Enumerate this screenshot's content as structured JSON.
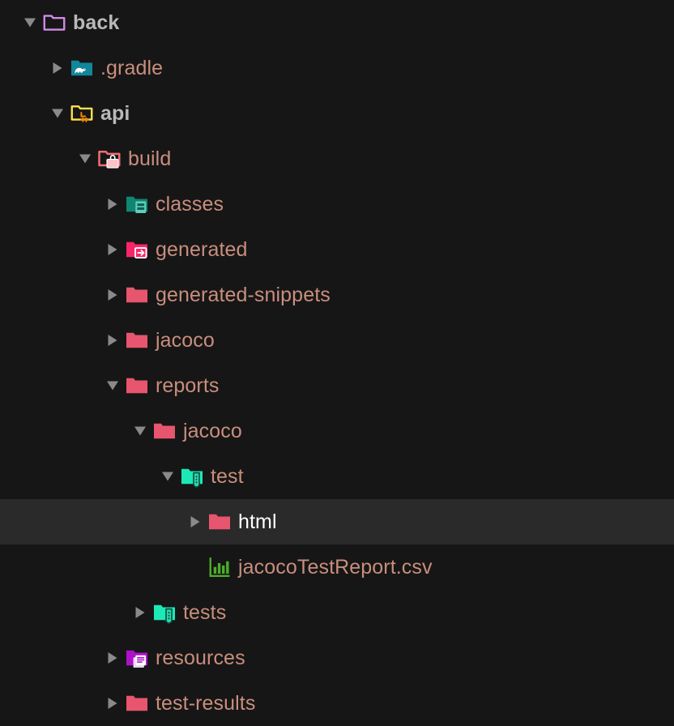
{
  "theme": {
    "background": "#161616",
    "selected_row_background": "#2a2a2a",
    "default_text_color": "#c98e7d",
    "root_text_color": "#b9b9b9",
    "selected_text_color": "#ffffff",
    "twisty_color": "#8a8a8a"
  },
  "file_tree": {
    "title": "back",
    "rows": [
      {
        "label": "back",
        "depth": 0,
        "twisty": "down",
        "icon": "folder-outline-purple-icon",
        "icon_color": "#d08ce8",
        "selected": false,
        "bold": true,
        "type": "folder"
      },
      {
        "label": ".gradle",
        "depth": 1,
        "twisty": "right",
        "icon": "folder-gradle-icon",
        "icon_color": "#11879b",
        "selected": false,
        "bold": false,
        "type": "folder"
      },
      {
        "label": "api",
        "depth": 1,
        "twisty": "down",
        "icon": "folder-module-yellow-icon",
        "icon_color": "#ffe14d",
        "selected": false,
        "bold": true,
        "type": "folder"
      },
      {
        "label": "build",
        "depth": 2,
        "twisty": "down",
        "icon": "folder-build-icon",
        "icon_color": "#ef6e74",
        "selected": false,
        "bold": false,
        "type": "folder"
      },
      {
        "label": "classes",
        "depth": 3,
        "twisty": "right",
        "icon": "folder-classes-icon",
        "icon_color": "#0f8573",
        "selected": false,
        "bold": false,
        "type": "folder"
      },
      {
        "label": "generated",
        "depth": 3,
        "twisty": "right",
        "icon": "folder-generated-icon",
        "icon_color": "#f9256b",
        "selected": false,
        "bold": false,
        "type": "folder"
      },
      {
        "label": "generated-snippets",
        "depth": 3,
        "twisty": "right",
        "icon": "folder-plain-pink-icon",
        "icon_color": "#e8556e",
        "selected": false,
        "bold": false,
        "type": "folder"
      },
      {
        "label": "jacoco",
        "depth": 3,
        "twisty": "right",
        "icon": "folder-plain-pink-icon",
        "icon_color": "#e8556e",
        "selected": false,
        "bold": false,
        "type": "folder"
      },
      {
        "label": "reports",
        "depth": 3,
        "twisty": "down",
        "icon": "folder-plain-pink-icon",
        "icon_color": "#e8556e",
        "selected": false,
        "bold": false,
        "type": "folder"
      },
      {
        "label": "jacoco",
        "depth": 4,
        "twisty": "down",
        "icon": "folder-plain-pink-icon",
        "icon_color": "#e8556e",
        "selected": false,
        "bold": false,
        "type": "folder"
      },
      {
        "label": "test",
        "depth": 5,
        "twisty": "down",
        "icon": "folder-test-icon",
        "icon_color": "#1de9b6",
        "selected": false,
        "bold": false,
        "type": "folder"
      },
      {
        "label": "html",
        "depth": 6,
        "twisty": "right",
        "icon": "folder-plain-pink-icon",
        "icon_color": "#e8556e",
        "selected": true,
        "bold": false,
        "type": "folder"
      },
      {
        "label": "jacocoTestReport.csv",
        "depth": 6,
        "twisty": "none",
        "icon": "csv-chart-icon",
        "icon_color": "#4caf27",
        "selected": false,
        "bold": false,
        "type": "file"
      },
      {
        "label": "tests",
        "depth": 4,
        "twisty": "right",
        "icon": "folder-test-icon",
        "icon_color": "#1de9b6",
        "selected": false,
        "bold": false,
        "type": "folder"
      },
      {
        "label": "resources",
        "depth": 3,
        "twisty": "right",
        "icon": "folder-resources-icon",
        "icon_color": "#ad12c9",
        "selected": false,
        "bold": false,
        "type": "folder"
      },
      {
        "label": "test-results",
        "depth": 3,
        "twisty": "right",
        "icon": "folder-plain-pink-icon",
        "icon_color": "#e8556e",
        "selected": false,
        "bold": false,
        "type": "folder"
      }
    ]
  }
}
